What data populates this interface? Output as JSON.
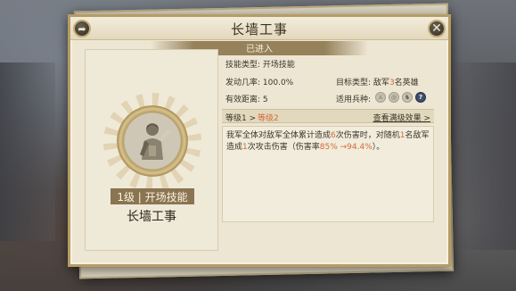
{
  "window": {
    "title": "长墙工事"
  },
  "notice": {
    "pre": "",
    "mid": "已进入",
    "post": ""
  },
  "skill": {
    "level_badge": "1级 | 开场技能",
    "name": "长墙工事",
    "type_label": "技能类型:",
    "type_value": "开场技能",
    "rate_label": "发动几率:",
    "rate_value": "100.0%",
    "range_label": "有效距离:",
    "range_value": "5",
    "target_label": "目标类型:",
    "target_pre": "敌军",
    "target_num": "3",
    "target_post": "名英雄",
    "arms_label": "适用兵种:",
    "arms": [
      "sword-icon",
      "bow-icon",
      "horse-icon",
      "question-icon"
    ]
  },
  "upgrade": {
    "from": "等级1 >",
    "to": "等级2",
    "view_full": "查看满级效果 >"
  },
  "description": {
    "p1": "我军全体对敌军全体累计造成",
    "n1": "6",
    "p2": "次伤害时，对随机",
    "n2": "1",
    "p3": "名敌军造成",
    "n3": "1",
    "p4": "次攻击伤害（伤害率",
    "n4": "85% →94.4%",
    "p5": "）。"
  },
  "colors": {
    "accent": "#d46a3a",
    "panel_bg": "#ede6d3",
    "border": "#b69c64"
  }
}
